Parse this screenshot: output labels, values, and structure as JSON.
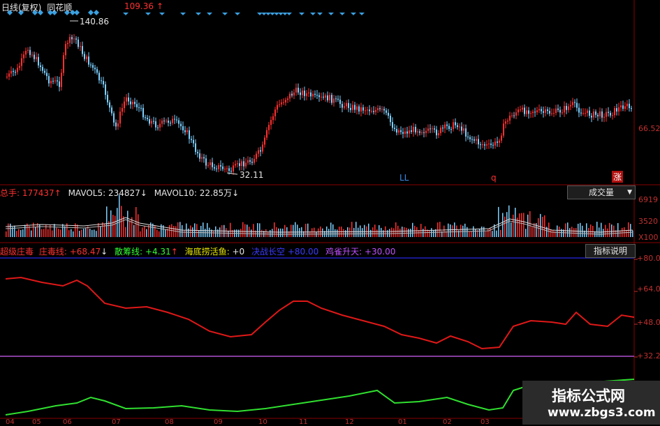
{
  "price_panel": {
    "title": "日线(复权)",
    "stock_name": "同花顺",
    "price_label": "109.36",
    "price_arrow": "↑",
    "high_label": "140.86",
    "low_label": "32.11",
    "marker_ll": "LL",
    "marker_q": "q",
    "marker_zhang": "涨",
    "axis_label": "66.52"
  },
  "volume_panel": {
    "total_label": "总手: 177437",
    "total_arrow": "↑",
    "mavol5_label": "MAVOL5: 234827",
    "mavol5_arrow": "↓",
    "mavol10_label": "MAVOL10: 22.85万",
    "mavol10_arrow": "↓",
    "dropdown_label": "成交量",
    "dropdown_icon": "▼",
    "axis_labels": [
      "6919",
      "3520",
      "X100"
    ]
  },
  "indicator_panel": {
    "name": "超级庄毒",
    "line1_label": "庄毒线:",
    "line1_value": "+68.47",
    "line1_arrow": "↓",
    "line2_label": "散筹线:",
    "line2_value": "+4.31",
    "line2_arrow": "↑",
    "line3_label": "海底捞活鱼:",
    "line3_value": "+0",
    "line4_label": "决战长空",
    "line4_value": "+80.00",
    "line5_label": "鸡雀升天:",
    "line5_value": "+30.00",
    "help_button": "指标说明",
    "axis_labels": [
      "+80.0",
      "+64.0",
      "+48.0",
      "+32.2"
    ]
  },
  "date_axis": [
    "04",
    "05",
    "06",
    "07",
    "08",
    "09",
    "10",
    "11",
    "12",
    "01",
    "02",
    "03"
  ],
  "watermark": {
    "title": "指标公式网",
    "url": "www.zbgs3.com"
  },
  "colors": {
    "up": "#ff3030",
    "down": "#7fd0ff",
    "marker": "#3aa0e0",
    "red_line": "#e01818",
    "green_line": "#30e030",
    "border": "#8a0000",
    "blue_line": "#2020c0",
    "purple_line": "#b050d0"
  }
}
